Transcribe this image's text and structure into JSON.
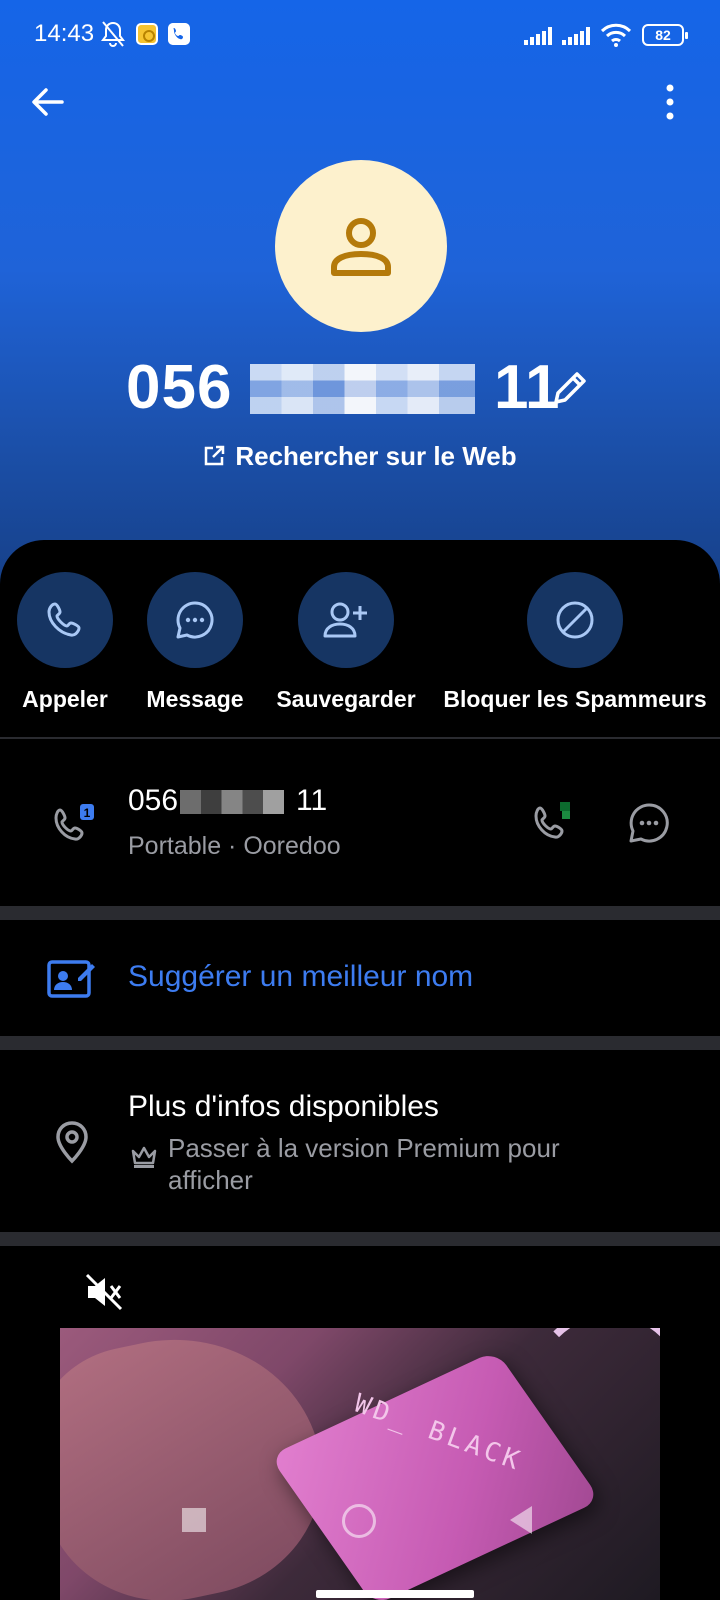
{
  "status_bar": {
    "time": "14:43",
    "battery": "82",
    "icons": [
      "bell-off-icon",
      "app-notification-icon",
      "truecaller-icon",
      "signal-icon",
      "signal-icon",
      "wifi-icon",
      "battery-icon"
    ]
  },
  "header": {
    "number_prefix": "056",
    "number_suffix": "11",
    "web_search_label": "Rechercher sur le Web",
    "colors": {
      "gradient_top": "#1565e8",
      "gradient_bottom": "#163f86",
      "avatar_bg": "#fdf1cd",
      "avatar_icon": "#b47a0b"
    }
  },
  "actions": [
    {
      "label": "Appeler",
      "icon": "phone-icon"
    },
    {
      "label": "Message",
      "icon": "chat-icon"
    },
    {
      "label": "Sauvegarder",
      "icon": "add-contact-icon"
    },
    {
      "label": "Bloquer les Spammeurs",
      "icon": "block-icon"
    }
  ],
  "phone_row": {
    "number_prefix": "056",
    "number_suffix": "11",
    "subtitle": "Portable · Ooredoo",
    "sim_badge": "1"
  },
  "suggest": {
    "label": "Suggérer un meilleur nom",
    "color": "#3d7cf0"
  },
  "info": {
    "title": "Plus d'infos disponibles",
    "subtitle": "Passer à la version Premium pour afficher"
  },
  "ad": {
    "product_text": "WD_ BLACK"
  }
}
